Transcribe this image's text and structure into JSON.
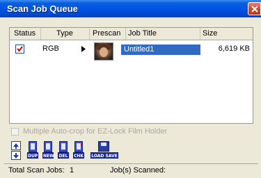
{
  "window": {
    "title": "Scan Job Queue"
  },
  "columns": [
    "Status",
    "Type",
    "Prescan",
    "Job Title",
    "Size"
  ],
  "rows": [
    {
      "checked": true,
      "type": "RGB",
      "job_title": "Untitled1",
      "size": "6,619 KB"
    }
  ],
  "option": {
    "label": "Multiple Auto-crop for EZ-Lock Film Holder",
    "enabled": false
  },
  "toolbar": {
    "dup_label": "DUP",
    "new_label": "NEW",
    "del_label": "DEL",
    "chk_label": "CHK",
    "loadsave_label": "LOAD SAVE"
  },
  "status": {
    "total_label": "Total Scan Jobs:",
    "total_value": "1",
    "scanned_label": "Job(s) Scanned:"
  },
  "colors": {
    "titlebar": "#0054e3",
    "selection": "#316ac5",
    "check": "#d00000"
  }
}
